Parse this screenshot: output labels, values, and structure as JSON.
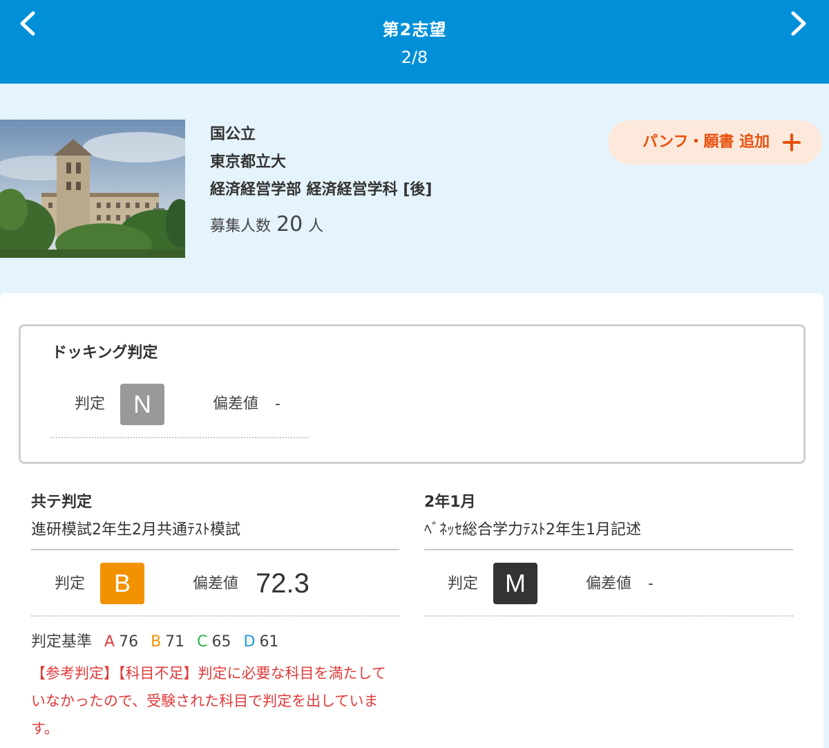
{
  "header": {
    "title": "第2志望",
    "page": "2/8",
    "prev_icon": "chevron-left-icon",
    "next_icon": "chevron-right-icon"
  },
  "school": {
    "type": "国公立",
    "name": "東京都立大",
    "department": "経済経営学部 経済経営学科 [後]",
    "capacity_label": "募集人数",
    "capacity_value": "20",
    "capacity_unit": "人"
  },
  "add_button": {
    "label": "パンフ・願書 追加",
    "icon": "plus-icon"
  },
  "docking": {
    "title": "ドッキング判定",
    "judgment_label": "判定",
    "judgment": "N",
    "judgment_color": "#999999",
    "deviation_label": "偏差値",
    "deviation": "-"
  },
  "kyote": {
    "title": "共テ判定",
    "exam": "進研模試2年生2月共通ﾃｽﾄ模試",
    "judgment_label": "判定",
    "judgment": "B",
    "judgment_color": "#f39200",
    "deviation_label": "偏差値",
    "deviation": "72.3",
    "criteria_label": "判定基準",
    "criteria": [
      {
        "grade": "A",
        "value": "76",
        "color": "#e03a3a"
      },
      {
        "grade": "B",
        "value": "71",
        "color": "#f39200"
      },
      {
        "grade": "C",
        "value": "65",
        "color": "#2eb04b"
      },
      {
        "grade": "D",
        "value": "61",
        "color": "#1b9ad6"
      }
    ],
    "note": "【参考判定】【科目不足】判定に必要な科目を満たしていなかったので、受験された科目で判定を出しています。"
  },
  "jan": {
    "title": "2年1月",
    "exam": "ﾍﾞﾈｯｾ総合学力ﾃｽﾄ2年生1月記述",
    "judgment_label": "判定",
    "judgment": "M",
    "judgment_color": "#333333",
    "deviation_label": "偏差値",
    "deviation": "-"
  }
}
